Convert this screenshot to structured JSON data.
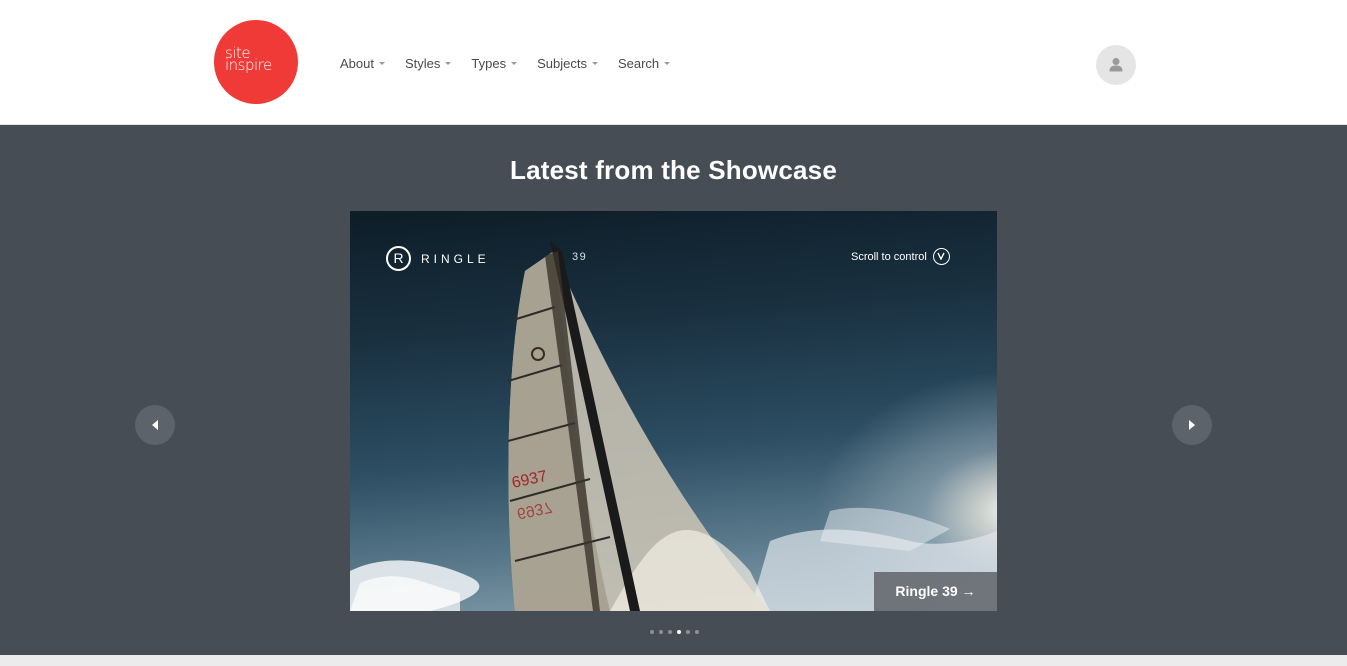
{
  "brand": {
    "logo_line1": "site",
    "logo_line2": "inspire",
    "color": "#f03a37"
  },
  "nav": {
    "items": [
      {
        "label": "About"
      },
      {
        "label": "Styles"
      },
      {
        "label": "Types"
      },
      {
        "label": "Subjects"
      },
      {
        "label": "Search"
      }
    ]
  },
  "showcase": {
    "title": "Latest from the Showcase",
    "background": "#474d54",
    "slide": {
      "brand_mark": "R",
      "brand_name": "RINGLE",
      "issue_number": "39",
      "scroll_hint": "Scroll to control",
      "caption": "Ringle 39 →"
    },
    "pagination": {
      "count": 6,
      "active_index": 3
    }
  },
  "icons": {
    "user": "user-icon",
    "prev": "chevron-left-icon",
    "next": "chevron-right-icon",
    "scroll": "scroll-down-icon"
  }
}
